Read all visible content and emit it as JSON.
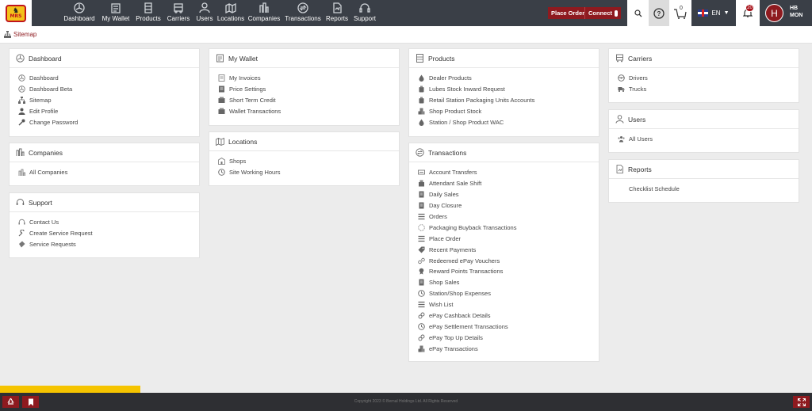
{
  "logo": {
    "text": "MRS"
  },
  "nav": [
    {
      "label": "Dashboard",
      "icon": "dashboard-icon"
    },
    {
      "label": "My Wallet",
      "icon": "wallet-icon"
    },
    {
      "label": "Products",
      "icon": "products-icon"
    },
    {
      "label": "Carriers",
      "icon": "carriers-icon"
    },
    {
      "label": "Users",
      "icon": "users-icon"
    },
    {
      "label": "Locations",
      "icon": "locations-icon"
    },
    {
      "label": "Companies",
      "icon": "companies-icon"
    },
    {
      "label": "Transactions",
      "icon": "transactions-icon"
    },
    {
      "label": "Reports",
      "icon": "reports-icon"
    },
    {
      "label": "Support",
      "icon": "support-icon"
    }
  ],
  "header": {
    "place_order": "Place Order",
    "connect": "Connect",
    "cart_count": "0",
    "language": "EN",
    "notification_count": "20",
    "avatar_letter": "H",
    "user_line1": "HB",
    "user_line2": "MON"
  },
  "breadcrumb": {
    "label": "Sitemap"
  },
  "cards": {
    "dashboard": {
      "title": "Dashboard",
      "links": [
        "Dashboard",
        "Dashboard Beta",
        "Sitemap",
        "Edit Profile",
        "Change Password"
      ]
    },
    "companies": {
      "title": "Companies",
      "links": [
        "All Companies"
      ]
    },
    "support": {
      "title": "Support",
      "links": [
        "Contact Us",
        "Create Service Request",
        "Service Requests"
      ]
    },
    "wallet": {
      "title": "My Wallet",
      "links": [
        "My Invoices",
        "Price Settings",
        "Short Term Credit",
        "Wallet Transactions"
      ]
    },
    "locations": {
      "title": "Locations",
      "links": [
        "Shops",
        "Site Working Hours"
      ]
    },
    "products": {
      "title": "Products",
      "links": [
        "Dealer Products",
        "Lubes Stock Inward Request",
        "Retail Station Packaging Units Accounts",
        "Shop Product Stock",
        "Station / Shop Product WAC"
      ]
    },
    "transactions": {
      "title": "Transactions",
      "links": [
        "Account Transfers",
        "Attendant Sale Shift",
        "Daily Sales",
        "Day Closure",
        "Orders",
        "Packaging Buyback Transactions",
        "Place Order",
        "Recent Payments",
        "Redeemed ePay Vouchers",
        "Reward Points Transactions",
        "Shop Sales",
        "Station/Shop Expenses",
        "Wish List",
        "ePay Cashback Details",
        "ePay Settlement Transactions",
        "ePay Top Up Details",
        "ePay Transactions"
      ]
    },
    "carriers": {
      "title": "Carriers",
      "links": [
        "Drivers",
        "Trucks"
      ]
    },
    "users": {
      "title": "Users",
      "links": [
        "All Users"
      ]
    },
    "reports": {
      "title": "Reports",
      "links": [
        "Checklist Schedule"
      ]
    }
  },
  "footer": {
    "copyright": "Copyright 2023 © Bernal Holdings Ltd. All Rights Reserved"
  },
  "colors": {
    "accent": "#8e1a1f",
    "topbar": "#3a3f47",
    "footer": "#2e2f33",
    "yellow": "#f5c400"
  }
}
